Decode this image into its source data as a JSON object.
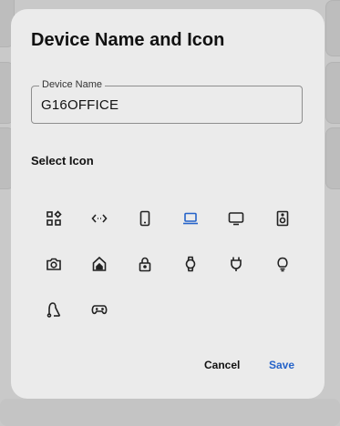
{
  "dialog": {
    "title": "Device Name and Icon",
    "device_name_label": "Device Name",
    "device_name_value": "G16OFFICE",
    "select_icon_label": "Select Icon",
    "cancel_label": "Cancel",
    "save_label": "Save"
  },
  "icons": [
    {
      "name": "apps-icon",
      "selected": false
    },
    {
      "name": "arrows-icon",
      "selected": false
    },
    {
      "name": "phone-icon",
      "selected": false
    },
    {
      "name": "laptop-icon",
      "selected": true
    },
    {
      "name": "tv-icon",
      "selected": false
    },
    {
      "name": "speaker-icon",
      "selected": false
    },
    {
      "name": "camera-icon",
      "selected": false
    },
    {
      "name": "home-icon",
      "selected": false
    },
    {
      "name": "lock-icon",
      "selected": false
    },
    {
      "name": "watch-icon",
      "selected": false
    },
    {
      "name": "plug-icon",
      "selected": false
    },
    {
      "name": "bulb-icon",
      "selected": false
    },
    {
      "name": "vacuum-icon",
      "selected": false
    },
    {
      "name": "gamepad-icon",
      "selected": false
    }
  ],
  "colors": {
    "accent": "#2563c9",
    "icon": "#222222"
  }
}
